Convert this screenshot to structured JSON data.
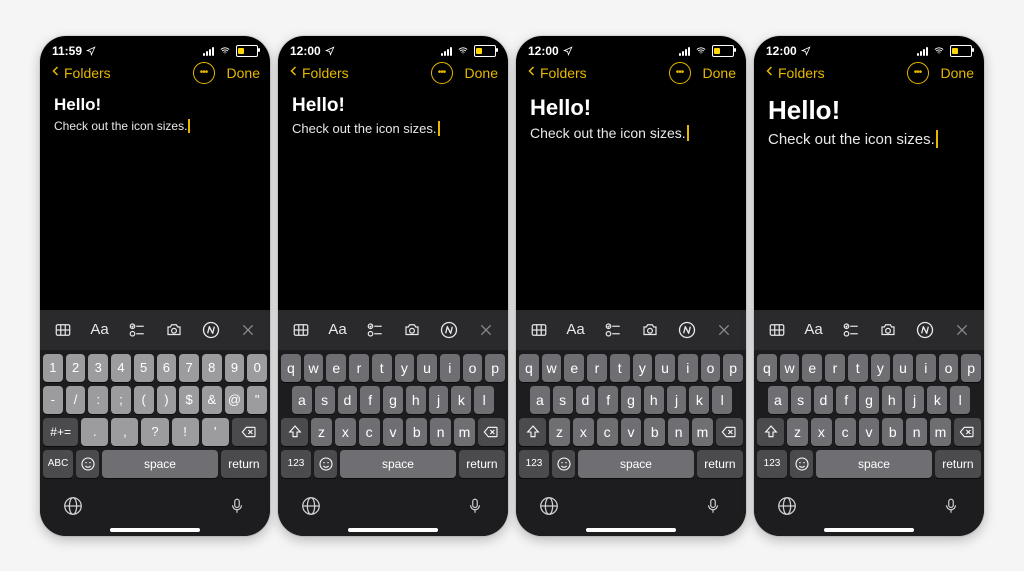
{
  "page_bg": "#f5f5f5",
  "accent": "#e6b800",
  "screens": [
    {
      "time": "11:59",
      "keyboard": "numeric",
      "scale": 0,
      "battery_pct": 40
    },
    {
      "time": "12:00",
      "keyboard": "qwerty",
      "scale": 1,
      "battery_pct": 40
    },
    {
      "time": "12:00",
      "keyboard": "qwerty",
      "scale": 2,
      "battery_pct": 40
    },
    {
      "time": "12:00",
      "keyboard": "qwerty",
      "scale": 3,
      "battery_pct": 40
    }
  ],
  "nav": {
    "back_label": "Folders",
    "done_label": "Done"
  },
  "note": {
    "title": "Hello!",
    "body": "Check out the icon sizes."
  },
  "tools": {
    "labels": [
      "table",
      "text-format",
      "checklist",
      "camera",
      "markup",
      "close"
    ],
    "aa_label": "Aa"
  },
  "keyboard": {
    "numeric": {
      "row1": [
        "1",
        "2",
        "3",
        "4",
        "5",
        "6",
        "7",
        "8",
        "9",
        "0"
      ],
      "row2": [
        "-",
        "/",
        ":",
        ";",
        "(",
        ")",
        "$",
        "&",
        "@",
        "\""
      ],
      "row3_func": "#+=",
      "row3": [
        ".",
        ",",
        "?",
        "!",
        "'"
      ],
      "abc_label": "ABC"
    },
    "qwerty": {
      "row1": [
        "q",
        "w",
        "e",
        "r",
        "t",
        "y",
        "u",
        "i",
        "o",
        "p"
      ],
      "row2": [
        "a",
        "s",
        "d",
        "f",
        "g",
        "h",
        "j",
        "k",
        "l"
      ],
      "row3": [
        "z",
        "x",
        "c",
        "v",
        "b",
        "n",
        "m"
      ],
      "num_label": "123"
    },
    "space_label": "space",
    "return_label": "return"
  }
}
